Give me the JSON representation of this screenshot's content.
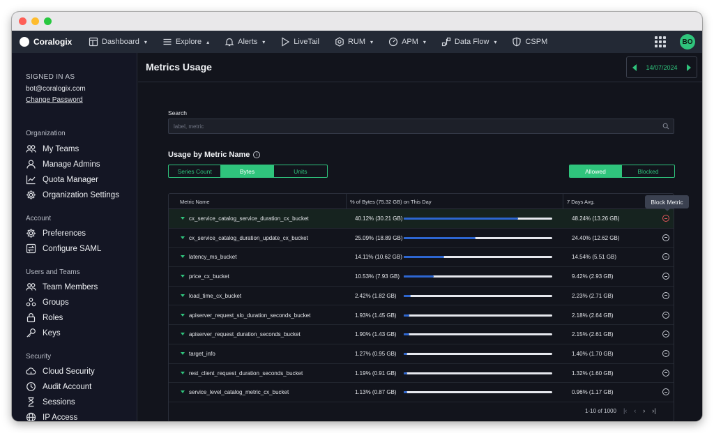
{
  "app": {
    "name": "Coralogix",
    "avatar": "BO"
  },
  "nav": [
    {
      "label": "Dashboard",
      "icon": "dashboard-icon",
      "caret": "▾"
    },
    {
      "label": "Explore",
      "icon": "explore-icon",
      "caret": "▴"
    },
    {
      "label": "Alerts",
      "icon": "bell-icon",
      "caret": "▾"
    },
    {
      "label": "LiveTail",
      "icon": "play-icon",
      "caret": ""
    },
    {
      "label": "RUM",
      "icon": "rum-icon",
      "caret": "▾"
    },
    {
      "label": "APM",
      "icon": "gauge-icon",
      "caret": "▾"
    },
    {
      "label": "Data Flow",
      "icon": "dataflow-icon",
      "caret": "▾"
    },
    {
      "label": "CSPM",
      "icon": "shield-icon",
      "caret": ""
    }
  ],
  "sidebar": {
    "signed_in_as": "SIGNED IN AS",
    "email": "bot@coralogix.com",
    "change_password": "Change Password",
    "sections": [
      {
        "title": "Organization",
        "items": [
          "My Teams",
          "Manage Admins",
          "Quota Manager",
          "Organization Settings"
        ]
      },
      {
        "title": "Account",
        "items": [
          "Preferences",
          "Configure SAML"
        ]
      },
      {
        "title": "Users and Teams",
        "items": [
          "Team Members",
          "Groups",
          "Roles",
          "Keys"
        ]
      },
      {
        "title": "Security",
        "items": [
          "Cloud Security",
          "Audit Account",
          "Sessions",
          "IP Access"
        ]
      }
    ]
  },
  "page": {
    "title": "Metrics Usage",
    "date": "14/07/2024",
    "search_label": "Search",
    "search_placeholder": "label, metric",
    "usage_title": "Usage by Metric Name",
    "tabs": [
      "Series Count",
      "Bytes",
      "Units"
    ],
    "active_tab": "Bytes",
    "filter": [
      "Allowed",
      "Blocked"
    ],
    "active_filter": "Allowed",
    "tooltip": "Block Metric",
    "pagination": "1-10 of 1000"
  },
  "table": {
    "columns": [
      "Metric Name",
      "% of Bytes (75.32 GB) on This Day",
      "7 Days Avg."
    ],
    "rows": [
      {
        "name": "cx_service_catalog_service_duration_cx_bucket",
        "pct": "40.12% (30.21 GB)",
        "share": 0.4012,
        "avg": "48.24% (13.26 GB)"
      },
      {
        "name": "cx_service_catalog_duration_update_cx_bucket",
        "pct": "25.09% (18.89 GB)",
        "share": 0.2509,
        "avg": "24.40% (12.62 GB)"
      },
      {
        "name": "latency_ms_bucket",
        "pct": "14.11% (10.62 GB)",
        "share": 0.1411,
        "avg": "14.54% (5.51 GB)"
      },
      {
        "name": "price_cx_bucket",
        "pct": "10.53% (7.93 GB)",
        "share": 0.1053,
        "avg": "9.42% (2.93 GB)"
      },
      {
        "name": "load_time_cx_bucket",
        "pct": "2.42% (1.82 GB)",
        "share": 0.0242,
        "avg": "2.23% (2.71 GB)"
      },
      {
        "name": "apiserver_request_slo_duration_seconds_bucket",
        "pct": "1.93% (1.45 GB)",
        "share": 0.0193,
        "avg": "2.18% (2.64 GB)"
      },
      {
        "name": "apiserver_request_duration_seconds_bucket",
        "pct": "1.90% (1.43 GB)",
        "share": 0.019,
        "avg": "2.15% (2.61 GB)"
      },
      {
        "name": "target_info",
        "pct": "1.27% (0.95 GB)",
        "share": 0.0127,
        "avg": "1.40% (1.70 GB)"
      },
      {
        "name": "rest_client_request_duration_seconds_bucket",
        "pct": "1.19% (0.91 GB)",
        "share": 0.0119,
        "avg": "1.32% (1.60 GB)"
      },
      {
        "name": "service_level_catalog_metric_cx_bucket",
        "pct": "1.13% (0.87 GB)",
        "share": 0.0113,
        "avg": "0.96% (1.17 GB)"
      }
    ]
  },
  "colors": {
    "accent": "#2fc47c",
    "bar": "#2d66d1",
    "danger": "#e0565b"
  }
}
